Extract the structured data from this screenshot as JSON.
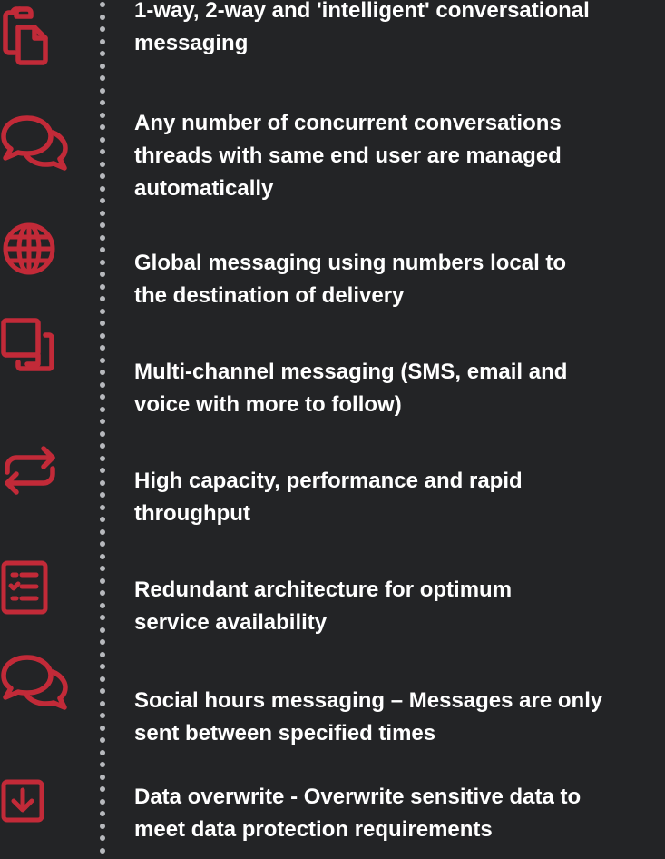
{
  "colors": {
    "background": "#232426",
    "accent": "#c22a38",
    "text": "#ffffff",
    "dots": "#b7b9bd"
  },
  "features": [
    {
      "icon": "clipboard-copy-icon",
      "text": "1-way, 2-way and 'intelligent' conversational\nmessaging"
    },
    {
      "icon": "chat-bubbles-icon",
      "text": "Any number of concurrent conversations\nthreads with same end user are managed\nautomatically"
    },
    {
      "icon": "globe-icon",
      "text": "Global messaging using numbers local to\nthe destination of delivery"
    },
    {
      "icon": "overlapping-squares-icon",
      "text": "Multi-channel messaging (SMS, email and\nvoice with more to follow)"
    },
    {
      "icon": "repeat-arrows-icon",
      "text": "High capacity, performance and rapid\nthroughput"
    },
    {
      "icon": "checklist-icon",
      "text": "Redundant architecture for optimum\nservice availability"
    },
    {
      "icon": "chat-bubbles-icon",
      "text": "Social hours messaging – Messages are only\nsent between specified times"
    },
    {
      "icon": "download-box-icon",
      "text": "Data overwrite - Overwrite sensitive data to\nmeet data protection requirements"
    }
  ]
}
